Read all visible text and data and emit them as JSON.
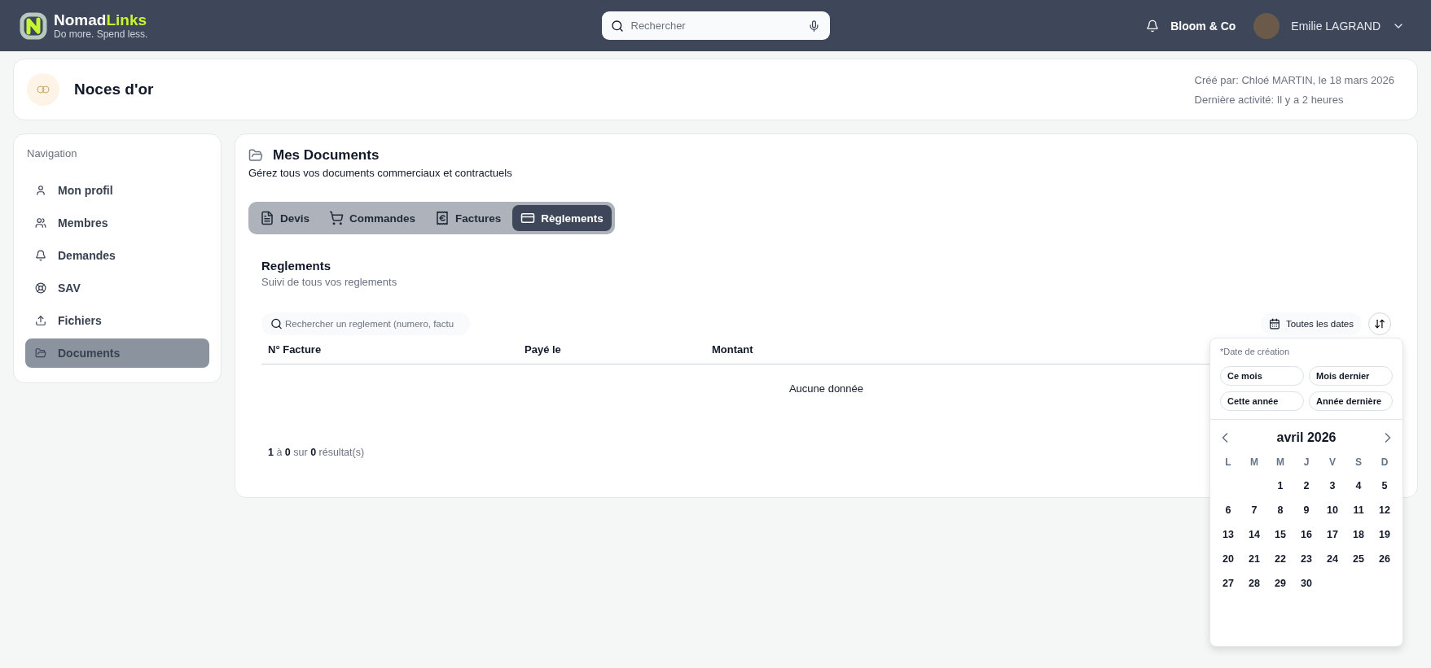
{
  "header": {
    "brand_first": "Nomad",
    "brand_second": "Links",
    "tagline": "Do more. Spend less.",
    "search": {
      "placeholder": "Rechercher"
    },
    "company": "Bloom & Co",
    "user": "Emilie LAGRAND"
  },
  "project": {
    "title": "Noces d'or",
    "created": "Créé par: Chloé MARTIN, le 18 mars 2026",
    "activity": "Dernière activité: Il y a 2 heures"
  },
  "sidebar": {
    "title": "Navigation",
    "items": [
      {
        "label": "Mon profil",
        "selected": false
      },
      {
        "label": "Membres",
        "selected": false
      },
      {
        "label": "Demandes",
        "selected": false
      },
      {
        "label": "SAV",
        "selected": false
      },
      {
        "label": "Fichiers",
        "selected": false
      },
      {
        "label": "Documents",
        "selected": true
      }
    ]
  },
  "documents": {
    "title": "Mes Documents",
    "subtitle": "Gérez tous vos documents commerciaux et contractuels",
    "tabs": [
      {
        "label": "Devis",
        "selected": false
      },
      {
        "label": "Commandes",
        "selected": false
      },
      {
        "label": "Factures",
        "selected": false
      },
      {
        "label": "Règlements",
        "selected": true
      }
    ],
    "section_title": "Reglements",
    "section_subtitle": "Suivi de tous vos reglements",
    "search": {
      "placeholder": "Rechercher un reglement (numero, factu"
    },
    "date_filter": "Toutes les dates",
    "table": {
      "columns": [
        "N° Facture",
        "Payé le",
        "Montant"
      ],
      "empty": "Aucune donnée"
    },
    "pagination": "**1** à **0** sur **0** résultat(s)"
  },
  "date_popover": {
    "label": "*Date de création",
    "presets": [
      "Ce mois",
      "Mois dernier",
      "Cette année",
      "Année dernière"
    ],
    "month": "avril 2026",
    "weekdays": [
      "L",
      "M",
      "M",
      "J",
      "V",
      "S",
      "D"
    ],
    "weeks": [
      [
        "1",
        "2",
        "3",
        "4",
        "5"
      ],
      [
        "6",
        "7",
        "8",
        "9",
        "10",
        "11",
        "12"
      ],
      [
        "13",
        "14",
        "15",
        "16",
        "17",
        "18",
        "19"
      ],
      [
        "20",
        "21",
        "22",
        "23",
        "24",
        "25",
        "26"
      ],
      [
        "27",
        "28",
        "29",
        "30"
      ]
    ]
  }
}
